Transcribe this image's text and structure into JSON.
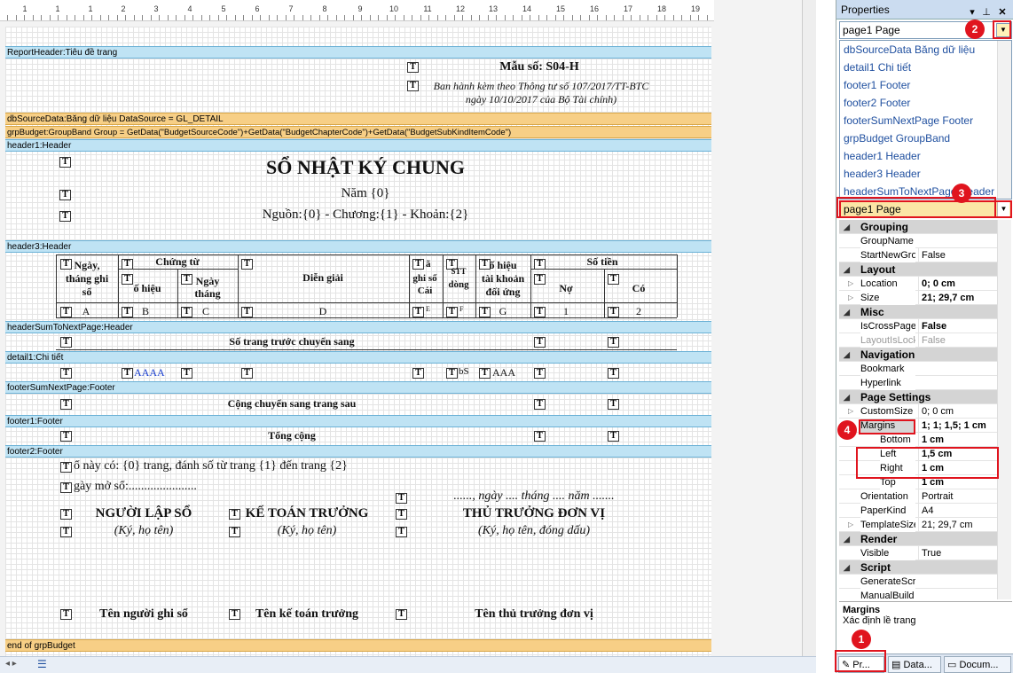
{
  "ruler": {
    "numbers": [
      "1",
      "1",
      "1",
      "2",
      "3",
      "4",
      "5",
      "6",
      "7",
      "8",
      "9",
      "10",
      "11",
      "12",
      "13",
      "14",
      "15",
      "16",
      "17",
      "18",
      "19"
    ]
  },
  "bands": {
    "report_header": "ReportHeader:Tiêu đề trang",
    "db_source": "dbSourceData:Băng dữ liệu DataSource = GL_DETAIL",
    "grp_budget": "grpBudget:GroupBand Group = GetData(\"BudgetSourceCode\")+GetData(\"BudgetChapterCode\")+GetData(\"BudgetSubKindItemCode\")",
    "header1": "header1:Header",
    "header3": "header3:Header",
    "header_sum": "headerSumToNextPage:Header",
    "detail1": "detail1:Chi tiết",
    "footer_sum": "footerSumNextPage:Footer",
    "footer1": "footer1:Footer",
    "footer2": "footer2:Footer",
    "end_grp": "end of grpBudget"
  },
  "report": {
    "t_marker": "T",
    "form_no": "Mẫu số: S04-H",
    "form_note1": "Ban hành kèm theo Thông tư số 107/2017/TT-BTC",
    "form_note2": "ngày 10/10/2017 của Bộ Tài chính)",
    "title": "SỔ NHẬT KÝ CHUNG",
    "year": "Năm {0}",
    "source": "Nguồn:{0} - Chương:{1} - Khoản:{2}",
    "col_date_1": "Ngày,",
    "col_date_2": "tháng ghi",
    "col_date_3": "sổ",
    "col_voucher": "Chứng từ",
    "col_voucher_no": "ố hiệu",
    "col_voucher_date_1": "Ngày",
    "col_voucher_date_2": "tháng",
    "col_desc": "Diễn giải",
    "col_ledger_1": "ã",
    "col_ledger_2": "ghi sổ",
    "col_ledger_3": "Cái",
    "col_stt_1": "STT",
    "col_stt_2": "dòng",
    "col_acc_1": "ố hiệu",
    "col_acc_2": "tài khoản",
    "col_acc_3": "đối ứng",
    "col_amount": "Số tiền",
    "col_debit": "Nợ",
    "col_credit": "Có",
    "code_a": "A",
    "code_b": "B",
    "code_c": "C",
    "code_d": "D",
    "code_e": "E",
    "code_f": "F",
    "code_g": "G",
    "code_1": "1",
    "code_2": "2",
    "carry_in": "Số trang trước chuyển sang",
    "detail_aaaa": "AAAA",
    "detail_bs": "bS",
    "detail_aaa": "AAA",
    "carry_out": "Cộng chuyển sang trang sau",
    "total": "Tổng cộng",
    "pages_note": "ổ này có: {0} trang, đánh số từ trang {1} đến trang {2}",
    "open_date": "gày mở sổ:......................",
    "date_line": "......, ngày .... tháng .... năm .......",
    "sig1_title": "NGƯỜI LẬP SỔ",
    "sig1_sub": "(Ký, họ tên)",
    "sig2_title": "KẾ TOÁN TRƯỞNG",
    "sig2_sub": "(Ký, họ tên)",
    "sig3_title": "THỦ TRƯỞNG ĐƠN VỊ",
    "sig3_sub": "(Ký, họ tên, đóng dấu)",
    "name1": "Tên người ghi sổ",
    "name2": "Tên kế toán trưởng",
    "name3": "Tên thủ trưởng đơn vị"
  },
  "properties": {
    "title": "Properties",
    "pin_icon": "pin-icon",
    "close_icon": "close-icon",
    "combo_value": "page1 Page",
    "dropdown_items": [
      "dbSourceData Băng dữ liệu",
      "detail1 Chi tiết",
      "footer1 Footer",
      "footer2 Footer",
      "footerSumNextPage Footer",
      "grpBudget GroupBand",
      "header1 Header",
      "header3 Header",
      "headerSumToNextPage Header"
    ],
    "selected_item": "page1 Page",
    "grid": {
      "cat_grouping": "Grouping",
      "group_name": "GroupName",
      "start_new": "StartNewGro",
      "start_new_val": "False",
      "cat_layout": "Layout",
      "location": "Location",
      "location_val": "0; 0 cm",
      "size": "Size",
      "size_val": "21; 29,7 cm",
      "cat_misc": "Misc",
      "is_cross": "IsCrossPage",
      "is_cross_val": "False",
      "layout_lock": "LayoutIsLock",
      "layout_lock_val": "False",
      "cat_nav": "Navigation",
      "bookmark": "Bookmark",
      "hyperlink": "Hyperlink",
      "cat_page": "Page Settings",
      "custom_size": "CustomSize",
      "custom_size_val": "0; 0 cm",
      "margins": "Margins",
      "margins_val": "1; 1; 1,5; 1 cm",
      "bottom": "Bottom",
      "bottom_val": "1 cm",
      "left": "Left",
      "left_val": "1,5 cm",
      "right": "Right",
      "right_val": "1 cm",
      "top": "Top",
      "top_val": "1 cm",
      "orientation": "Orientation",
      "orientation_val": "Portrait",
      "paper_kind": "PaperKind",
      "paper_kind_val": "A4",
      "template_size": "TemplateSize",
      "template_size_val": "21; 29,7 cm",
      "cat_render": "Render",
      "visible": "Visible",
      "visible_val": "True",
      "cat_script": "Script",
      "gen_script": "GenerateScri",
      "manual_build": "ManualBuild"
    },
    "desc_title": "Margins",
    "desc_text": "Xác định lề trang",
    "tabs": [
      "Pr...",
      "Data...",
      "Docum..."
    ]
  },
  "badges": [
    "1",
    "2",
    "3",
    "4"
  ],
  "colors": {
    "band_blue": "#bfe3f4",
    "band_orange": "#f7cf86",
    "highlight": "#e0141e"
  }
}
